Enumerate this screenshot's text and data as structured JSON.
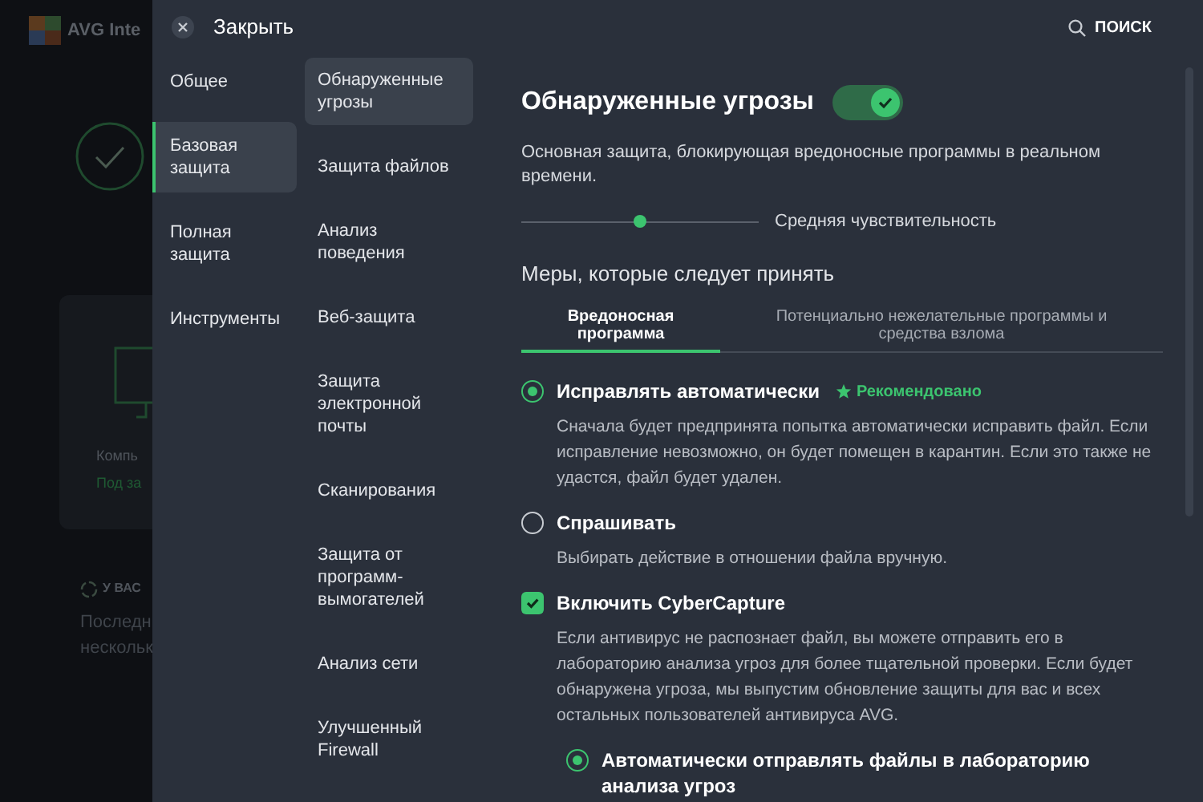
{
  "background_app": {
    "logo_text": "AVG Inte",
    "card_title": "Компь",
    "card_status": "Под за",
    "status_heading": "У ВАС",
    "status_lines": [
      "Последн",
      "нескольк"
    ]
  },
  "close": {
    "label": "Закрыть"
  },
  "search": {
    "label": "ПОИСК"
  },
  "categories": [
    {
      "label": "Общее",
      "selected": false
    },
    {
      "label": "Базовая защита",
      "selected": true
    },
    {
      "label": "Полная защита",
      "selected": false
    },
    {
      "label": "Инструменты",
      "selected": false
    }
  ],
  "subcategories": [
    {
      "label": "Обнаруженные угрозы",
      "selected": true
    },
    {
      "label": "Защита файлов",
      "selected": false
    },
    {
      "label": "Анализ поведения",
      "selected": false
    },
    {
      "label": "Веб-защита",
      "selected": false
    },
    {
      "label": "Защита электронной почты",
      "selected": false
    },
    {
      "label": "Сканирования",
      "selected": false
    },
    {
      "label": "Защита от программ-вымогателей",
      "selected": false
    },
    {
      "label": "Анализ сети",
      "selected": false
    },
    {
      "label": "Улучшенный Firewall",
      "selected": false
    }
  ],
  "content": {
    "title": "Обнаруженные угрозы",
    "on": true,
    "description": "Основная защита, блокирующая вредоносные программы в реальном времени.",
    "sensitivity": {
      "level": 0.5,
      "label": "Средняя чувствительность"
    },
    "actions_heading": "Меры, которые следует принять",
    "tabs": [
      {
        "label": "Вредоносная программа",
        "selected": true
      },
      {
        "label": "Потенциально нежелательные программы и средства взлома",
        "selected": false
      }
    ],
    "options": [
      {
        "kind": "radio",
        "label": "Исправлять автоматически",
        "selected": true,
        "badge": "Рекомендовано",
        "description": "Сначала будет предпринята попытка автоматически исправить файл. Если исправление невозможно, он будет помещен в карантин. Если это также не удастся, файл будет удален."
      },
      {
        "kind": "radio",
        "label": "Спрашивать",
        "selected": false,
        "description": "Выбирать действие в отношении файла вручную."
      },
      {
        "kind": "checkbox",
        "label": "Включить CyberCapture",
        "checked": true,
        "description": "Если антивирус не распознает файл, вы можете отправить его в лабораторию анализа угроз для более тщательной проверки. Если будет обнаружена угроза, мы выпустим обновление защиты для вас и всех остальных пользователей антивируса AVG."
      },
      {
        "kind": "subradio",
        "label": "Автоматически отправлять файлы в лабораторию анализа угроз",
        "selected": true
      }
    ]
  }
}
